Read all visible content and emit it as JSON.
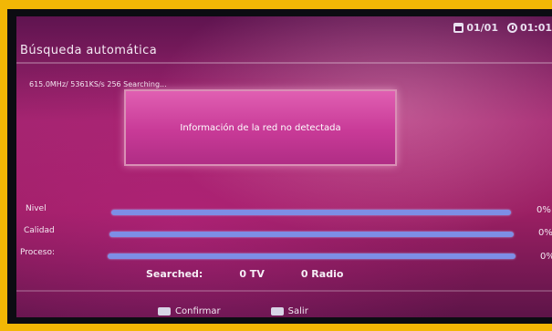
{
  "screen": {
    "title": "Búsqueda automática",
    "status": {
      "date": "01/01",
      "time": "01:01"
    },
    "scan_info": "615.0MHz/ 5361KS/s 256 Searching...",
    "dialog_message": "Información de la red no detectada",
    "meters": [
      {
        "label": "Nivel",
        "value": "0%"
      },
      {
        "label": "Calidad",
        "value": "0%"
      },
      {
        "label": "Proceso:",
        "value": "0%"
      }
    ],
    "searched": {
      "label": "Searched:",
      "tv": "0 TV",
      "radio": "0 Radio"
    },
    "footer": {
      "confirm_label": "Confirmar",
      "exit_label": "Salir"
    },
    "colors": {
      "background": "#a2246e",
      "dialog": "#c83a97",
      "bars": "#7d8ee6",
      "frame": "#f2b705"
    }
  }
}
